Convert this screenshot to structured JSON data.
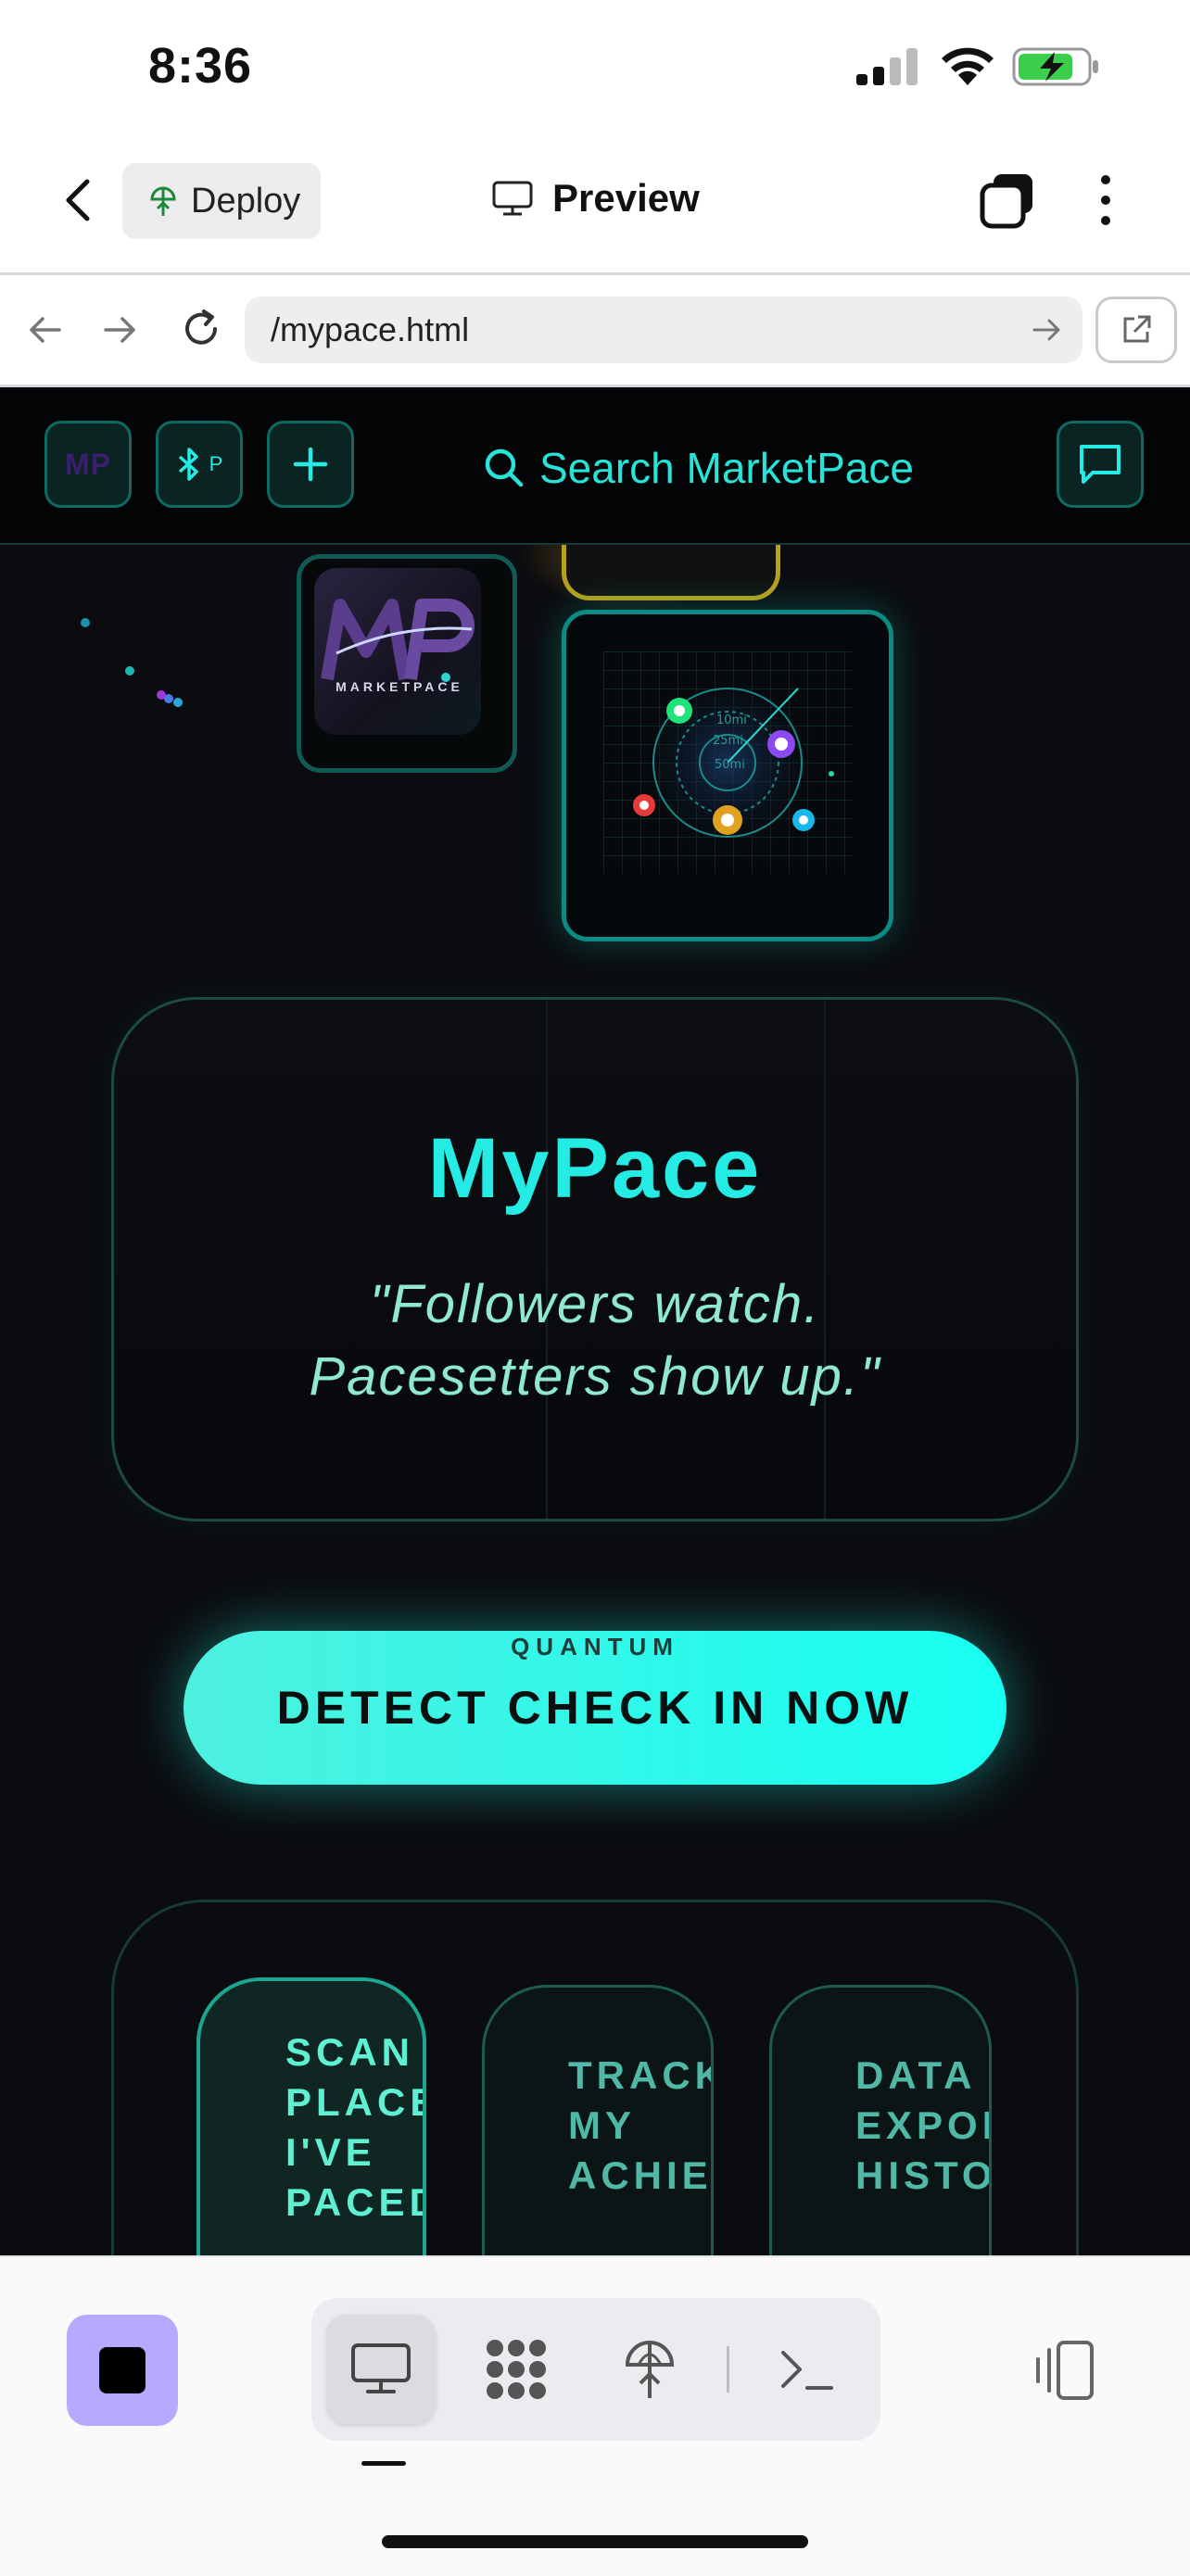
{
  "status_bar": {
    "time": "8:36"
  },
  "app_header": {
    "deploy_label": "Deploy",
    "preview_label": "Preview"
  },
  "browser": {
    "url": "/mypace.html"
  },
  "site": {
    "logo_text": "MP",
    "bluetooth_label": "P",
    "search_placeholder": "Search MarketPace",
    "logo_card_word": "MARKETPACE",
    "radar_labels": [
      "10mi",
      "25mi",
      "50mi"
    ],
    "hero": {
      "title": "MyPace",
      "quote_line1": "\"Followers watch.",
      "quote_line2": "Pacesetters show up.\""
    },
    "cta": {
      "kicker": "QUANTUM",
      "label": "DETECT CHECK IN NOW"
    },
    "actions": [
      {
        "label": "SCAN\nPLACE\nI'VE\nPACED"
      },
      {
        "label": "TRACK\nMY\nACHIEV"
      },
      {
        "label": "DATA\nEXPOR\nHISTO"
      }
    ],
    "colors": {
      "accent": "#25ebe5",
      "background": "#0b0c0f",
      "stop_button": "#b9a8ff"
    }
  }
}
